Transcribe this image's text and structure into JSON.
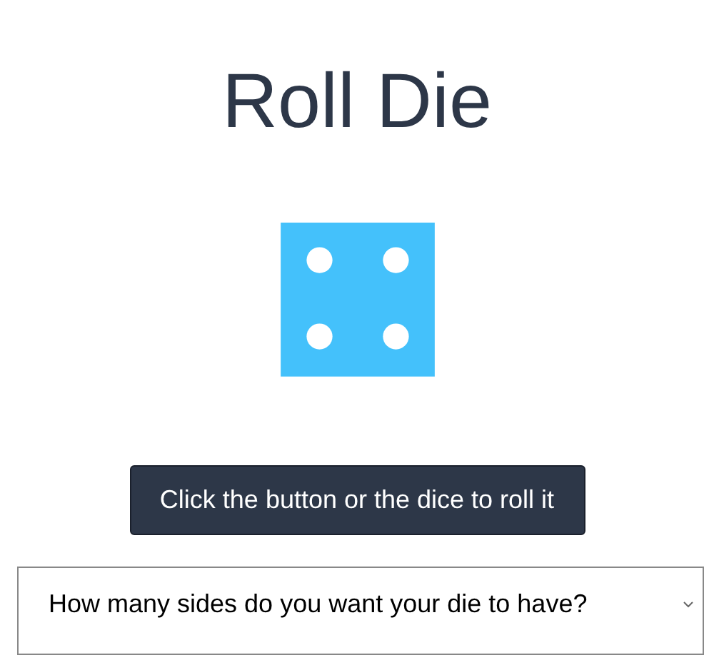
{
  "title": "Roll Die",
  "die": {
    "pips": [
      {
        "kind": "top-left"
      },
      {
        "kind": "top-right"
      },
      {
        "kind": "bottom-left"
      },
      {
        "kind": "bottom-right"
      }
    ]
  },
  "roll_button": {
    "label": "Click the button or the dice to roll it"
  },
  "sides_select": {
    "placeholder": "How many sides do you want your die to have?"
  }
}
